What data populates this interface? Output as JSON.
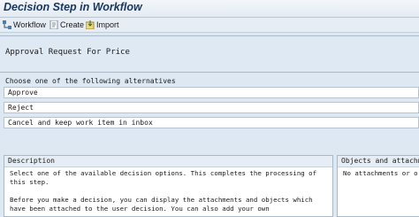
{
  "window": {
    "title": "Decision Step in Workflow"
  },
  "toolbar": {
    "workflow": {
      "label": "Workflow",
      "icon": "workflow-icon"
    },
    "create": {
      "label": "Create",
      "icon": "create-document-icon"
    },
    "import": {
      "label": "Import",
      "icon": "import-icon"
    }
  },
  "header": {
    "text": "Approval Request For Price"
  },
  "decision": {
    "prompt": "Choose one of the following alternatives",
    "options": [
      {
        "label": "Approve"
      },
      {
        "label": "Reject"
      },
      {
        "label": "Cancel and keep work item in inbox"
      }
    ]
  },
  "description": {
    "title": "Description",
    "lines": [
      "Select one of the available decision options. This completes the processing of",
      "this step.",
      "",
      "Before you make a decision, you can display the attachments and objects which",
      "have been attached to the user decision. You can also add your own"
    ]
  },
  "objects": {
    "title": "Objects and attachme",
    "empty_text": "No attachments or o"
  },
  "colors": {
    "title": "#17375e",
    "background": "#dde8f2",
    "panel_header": "#e6edf5"
  }
}
